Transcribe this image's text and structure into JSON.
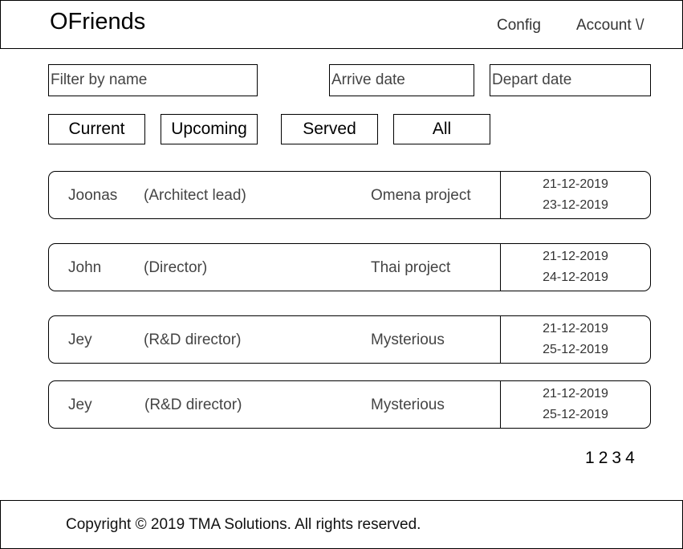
{
  "header": {
    "logo": "OFriends",
    "nav": {
      "config": "Config",
      "account": "Account \\/"
    }
  },
  "filters": {
    "name_placeholder": "Filter by name",
    "arrive_placeholder": "Arrive date",
    "depart_placeholder": "Depart date",
    "tabs": [
      "Current",
      "Upcoming",
      "Served",
      "All"
    ]
  },
  "visits": [
    {
      "name": "Joonas",
      "role": "(Architect lead)",
      "project": "Omena project",
      "arrive": "21-12-2019",
      "depart": "23-12-2019"
    },
    {
      "name": "John",
      "role": "(Director)",
      "project": "Thai project",
      "arrive": "21-12-2019",
      "depart": "24-12-2019"
    },
    {
      "name": "Jey",
      "role": "(R&D director)",
      "project": "Mysterious",
      "arrive": "21-12-2019",
      "depart": "25-12-2019"
    },
    {
      "name": "Jey",
      "role": "(R&D director)",
      "project": "Mysterious",
      "arrive": "21-12-2019",
      "depart": "25-12-2019"
    }
  ],
  "pagination": {
    "pages": [
      "1",
      "2",
      "3",
      "4"
    ]
  },
  "footer": {
    "copyright": "Copyright © 2019 TMA Solutions. All rights reserved."
  }
}
